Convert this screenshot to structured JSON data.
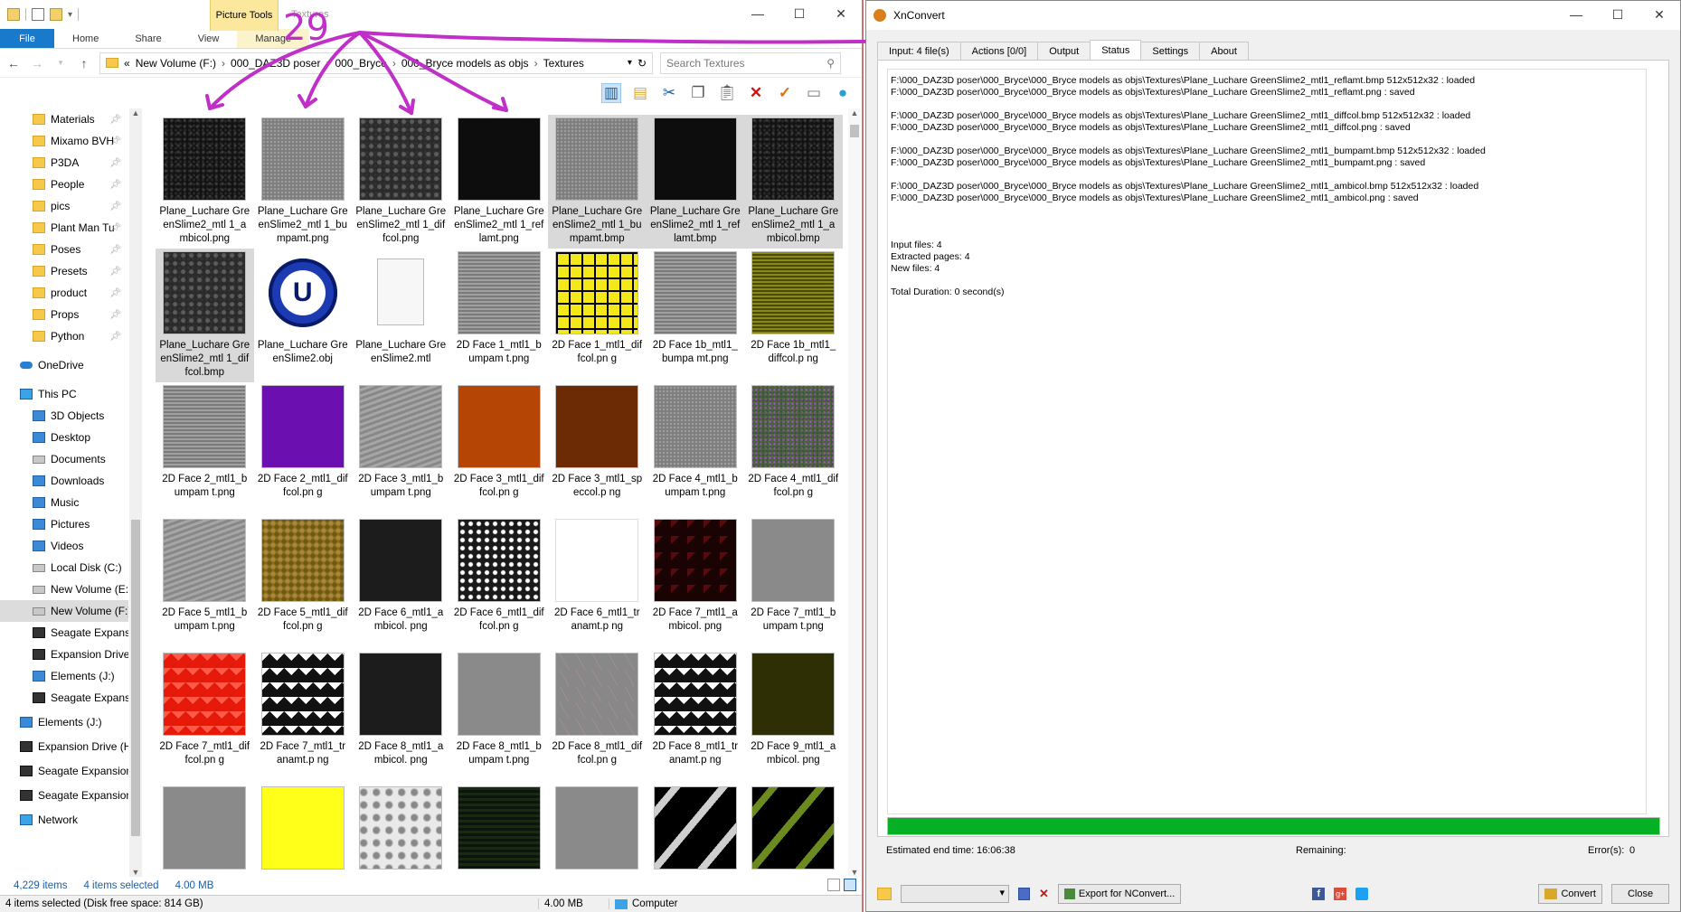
{
  "explorer": {
    "picture_tools": "Picture Tools",
    "window_title": "Textures",
    "ribbon_tabs": [
      "File",
      "Home",
      "Share",
      "View",
      "Manage"
    ],
    "address": [
      "«",
      "New Volume (F:)",
      "000_DAZ3D poser",
      "000_Bryce",
      "000_Bryce models as objs",
      "Textures"
    ],
    "search_placeholder": "Search Textures",
    "nav_items": [
      {
        "label": "Materials",
        "pinned": true
      },
      {
        "label": "Mixamo BVH",
        "pinned": true
      },
      {
        "label": "P3DA",
        "pinned": true
      },
      {
        "label": "People",
        "pinned": true
      },
      {
        "label": "pics",
        "pinned": true
      },
      {
        "label": "Plant Man Tu",
        "pinned": true
      },
      {
        "label": "Poses",
        "pinned": true
      },
      {
        "label": "Presets",
        "pinned": true
      },
      {
        "label": "product",
        "pinned": true
      },
      {
        "label": "Props",
        "pinned": true
      },
      {
        "label": "Python",
        "pinned": true
      }
    ],
    "nav_onedrive": "OneDrive",
    "nav_thispc": "This PC",
    "nav_pc_items": [
      "3D Objects",
      "Desktop",
      "Documents",
      "Downloads",
      "Music",
      "Pictures",
      "Videos",
      "Local Disk (C:)",
      "New Volume (E:)",
      "New Volume (F:)",
      "Seagate Expansic",
      "Expansion Drive",
      "Elements (J:)",
      "Seagate Expansic"
    ],
    "nav_more": [
      "Elements (J:)",
      "Expansion Drive (H",
      "Seagate Expansion",
      "Seagate Expansion"
    ],
    "nav_network": "Network",
    "files": [
      {
        "name": "Plane_Luchare GreenSlime2_mtl 1_ambicol.png",
        "tex": "speck"
      },
      {
        "name": "Plane_Luchare GreenSlime2_mtl 1_bumpamt.png",
        "tex": "noise"
      },
      {
        "name": "Plane_Luchare GreenSlime2_mtl 1_diffcol.png",
        "tex": "rock"
      },
      {
        "name": "Plane_Luchare GreenSlime2_mtl 1_reflamt.png",
        "tex": "black"
      },
      {
        "name": "Plane_Luchare GreenSlime2_mtl 1_bumpamt.bmp",
        "tex": "noise",
        "selected": true
      },
      {
        "name": "Plane_Luchare GreenSlime2_mtl 1_reflamt.bmp",
        "tex": "black",
        "selected": true
      },
      {
        "name": "Plane_Luchare GreenSlime2_mtl 1_ambicol.bmp",
        "tex": "speck",
        "selected": true
      },
      {
        "name": "Plane_Luchare GreenSlime2_mtl 1_diffcol.bmp",
        "tex": "rock",
        "selected": true
      },
      {
        "name": "Plane_Luchare GreenSlime2.obj",
        "tex": "uicon"
      },
      {
        "name": "Plane_Luchare GreenSlime2.mtl",
        "tex": "doc"
      },
      {
        "name": "2D Face 1_mtl1_bumpam t.png",
        "tex": "lines"
      },
      {
        "name": "2D Face 1_mtl1_diffcol.pn g",
        "tex": "yellowgrid"
      },
      {
        "name": "2D Face 1b_mtl1_bumpa mt.png",
        "tex": "lines"
      },
      {
        "name": "2D Face 1b_mtl1_diffcol.p ng",
        "tex": "olivegrid"
      },
      {
        "name": "2D Face 2_mtl1_bumpam t.png",
        "tex": "lines"
      },
      {
        "name": "2D Face 2_mtl1_diffcol.pn g",
        "tex": "purple"
      },
      {
        "name": "2D Face 3_mtl1_bumpam t.png",
        "tex": "wave"
      },
      {
        "name": "2D Face 3_mtl1_diffcol.pn g",
        "tex": "orange"
      },
      {
        "name": "2D Face 3_mtl1_speccol.p ng",
        "tex": "brown"
      },
      {
        "name": "2D Face 4_mtl1_bumpam t.png",
        "tex": "noise"
      },
      {
        "name": "2D Face 4_mtl1_diffcol.pn g",
        "tex": "colorful"
      },
      {
        "name": "2D Face 5_mtl1_bumpam t.png",
        "tex": "wave"
      },
      {
        "name": "2D Face 5_mtl1_diffcol.pn g",
        "tex": "mottle"
      },
      {
        "name": "2D Face 6_mtl1_ambicol. png",
        "tex": "darkgray"
      },
      {
        "name": "2D Face 6_mtl1_diffcol.pn g",
        "tex": "dots"
      },
      {
        "name": "2D Face 6_mtl1_tranamt.p ng",
        "tex": "white"
      },
      {
        "name": "2D Face 7_mtl1_ambicol. png",
        "tex": "redtri"
      },
      {
        "name": "2D Face 7_mtl1_bumpam t.png",
        "tex": "mid"
      },
      {
        "name": "2D Face 7_mtl1_diffcol.pn g",
        "tex": "tri-red"
      },
      {
        "name": "2D Face 7_mtl1_tranamt.p ng",
        "tex": "tri-black"
      },
      {
        "name": "2D Face 8_mtl1_ambicol. png",
        "tex": "darkgray"
      },
      {
        "name": "2D Face 8_mtl1_bumpam t.png",
        "tex": "mid"
      },
      {
        "name": "2D Face 8_mtl1_diffcol.pn g",
        "tex": "pinkgrid"
      },
      {
        "name": "2D Face 8_mtl1_tranamt.p ng",
        "tex": "tri-black"
      },
      {
        "name": "2D Face 9_mtl1_ambicol. png",
        "tex": "olive"
      },
      {
        "name": "",
        "tex": "mid"
      },
      {
        "name": "",
        "tex": "yellow"
      },
      {
        "name": "",
        "tex": "marble"
      },
      {
        "name": "",
        "tex": "darkgreen"
      },
      {
        "name": "",
        "tex": "mid"
      },
      {
        "name": "",
        "tex": "stripe"
      },
      {
        "name": "",
        "tex": "stripe-g"
      }
    ],
    "status_items": "4,229 items",
    "status_selected": "4 items selected",
    "status_size": "4.00 MB",
    "details_left": "4 items selected (Disk free space: 814 GB)",
    "details_size": "4.00 MB",
    "details_computer": "Computer"
  },
  "annotation": {
    "number": "29",
    "color": "#c030c8"
  },
  "xnconvert": {
    "title": "XnConvert",
    "tabs": [
      "Input: 4 file(s)",
      "Actions [0/0]",
      "Output",
      "Status",
      "Settings",
      "About"
    ],
    "active_tab": "Status",
    "log_groups": [
      [
        "F:\\000_DAZ3D poser\\000_Bryce\\000_Bryce models as objs\\Textures\\Plane_Luchare GreenSlime2_mtl1_reflamt.bmp 512x512x32 : loaded",
        "F:\\000_DAZ3D poser\\000_Bryce\\000_Bryce models as objs\\Textures\\Plane_Luchare GreenSlime2_mtl1_reflamt.png : saved"
      ],
      [
        "F:\\000_DAZ3D poser\\000_Bryce\\000_Bryce models as objs\\Textures\\Plane_Luchare GreenSlime2_mtl1_diffcol.bmp 512x512x32 : loaded",
        "F:\\000_DAZ3D poser\\000_Bryce\\000_Bryce models as objs\\Textures\\Plane_Luchare GreenSlime2_mtl1_diffcol.png : saved"
      ],
      [
        "F:\\000_DAZ3D poser\\000_Bryce\\000_Bryce models as objs\\Textures\\Plane_Luchare GreenSlime2_mtl1_bumpamt.bmp 512x512x32 : loaded",
        "F:\\000_DAZ3D poser\\000_Bryce\\000_Bryce models as objs\\Textures\\Plane_Luchare GreenSlime2_mtl1_bumpamt.png : saved"
      ],
      [
        "F:\\000_DAZ3D poser\\000_Bryce\\000_Bryce models as objs\\Textures\\Plane_Luchare GreenSlime2_mtl1_ambicol.bmp 512x512x32 : loaded",
        "F:\\000_DAZ3D poser\\000_Bryce\\000_Bryce models as objs\\Textures\\Plane_Luchare GreenSlime2_mtl1_ambicol.png : saved"
      ]
    ],
    "summary": [
      "Input files: 4",
      "Extracted pages: 4",
      "New files: 4"
    ],
    "duration": "Total Duration: 0 second(s)",
    "progress": 1.0,
    "progress_color": "#06b025",
    "end_time_label": "Estimated end time:",
    "end_time": "16:06:38",
    "remaining_label": "Remaining:",
    "errors_label": "Error(s):",
    "errors": "0",
    "export_button": "Export for NConvert...",
    "convert_button": "Convert",
    "close_button": "Close"
  }
}
